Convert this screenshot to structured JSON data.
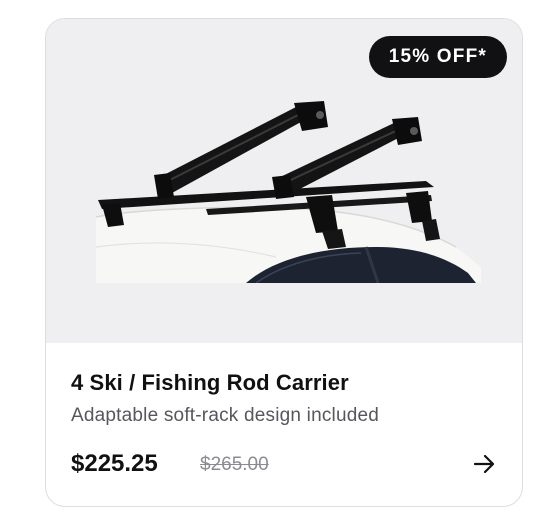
{
  "product": {
    "badge": "15% OFF*",
    "title": "4 Ski / Fishing Rod Carrier",
    "subtitle": "Adaptable soft-rack design included",
    "price": "$225.25",
    "original_price": "$265.00",
    "image_icon": "ski-rack-on-car-image",
    "action_icon": "arrow-right-icon"
  },
  "colors": {
    "badge_bg": "#111114",
    "media_bg": "#efeff2",
    "text_primary": "#111114",
    "text_secondary": "#55575d",
    "text_strikethrough": "#8a8c92"
  }
}
